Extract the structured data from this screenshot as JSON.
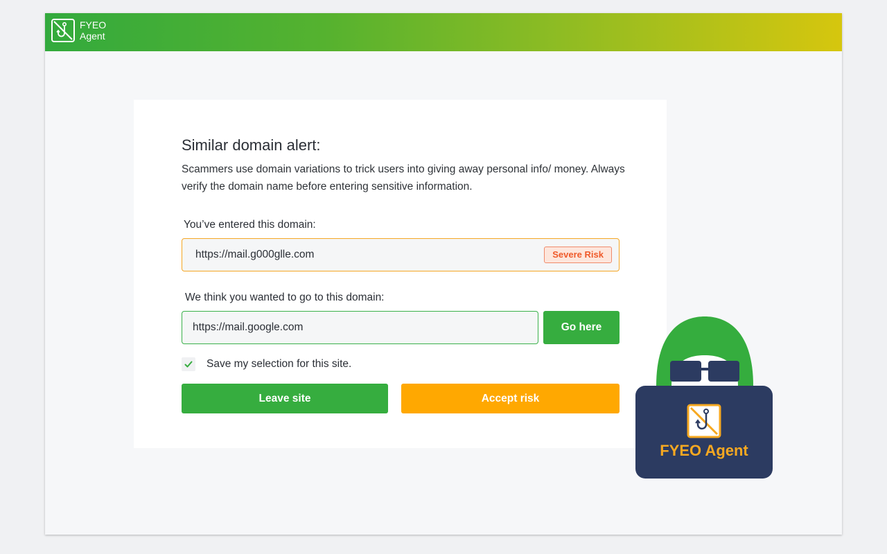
{
  "app": {
    "brand_line1": "FYEO",
    "brand_line2": "Agent",
    "logo_icon": "fishing-hook-icon"
  },
  "alert": {
    "title": "Similar domain alert:",
    "description": "Scammers use domain variations to trick users into giving away personal info/ money. Always verify the domain name before entering sensitive information.",
    "entered_label": "You’ve entered this domain:",
    "entered_domain": "https://mail.g000glle.com",
    "risk_badge": "Severe Risk",
    "suggested_label": "We think you wanted to go to this domain:",
    "suggested_domain": "https://mail.google.com",
    "go_button": "Go here",
    "save_selection_label": "Save my selection for this site.",
    "save_selection_checked": true,
    "leave_button": "Leave site",
    "accept_button": "Accept risk"
  },
  "mascot": {
    "label": "FYEO Agent"
  },
  "colors": {
    "header_gradient_start": "#33aa3d",
    "header_gradient_end": "#d6c60e",
    "primary_green": "#36ad3f",
    "warning_orange": "#ffa801",
    "risk_red": "#ef5a2a",
    "mascot_navy": "#2c3b61"
  }
}
